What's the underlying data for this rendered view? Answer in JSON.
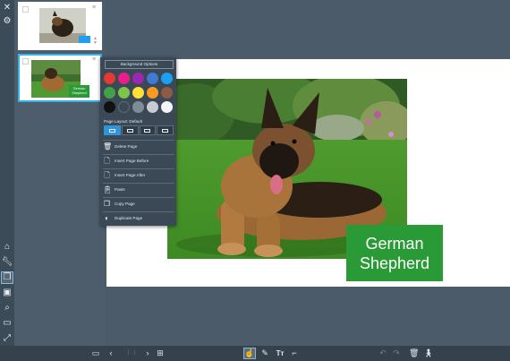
{
  "thumbnails": {
    "pages": [
      {
        "selected": false
      },
      {
        "selected": true,
        "caption_text": "German Shepherd"
      }
    ]
  },
  "canvas": {
    "caption": "German\nShepherd",
    "caption_color": "#2a9a36"
  },
  "popup": {
    "background_options_label": "Background Options",
    "swatch_colors": [
      "#e53935",
      "#e91e8c",
      "#9c27b0",
      "#3f7ad6",
      "#1ea0f2",
      "#43a047",
      "#7cc44a",
      "#ffe033",
      "#fb9a1e",
      "#8d5a43",
      "#111111",
      "#3b4957",
      "#7f8c96",
      "#c8cdd1",
      "#f3f5f6"
    ],
    "page_layout_label": "Page Layout: Default",
    "menu_items": [
      {
        "label": "Delete Page",
        "icon": "trash-icon"
      },
      {
        "label": "Insert Page Before",
        "icon": "insert-before-icon"
      },
      {
        "label": "Insert Page After",
        "icon": "insert-after-icon"
      },
      {
        "label": "Paste",
        "icon": "paste-icon"
      },
      {
        "label": "Copy Page",
        "icon": "copy-icon"
      },
      {
        "label": "Duplicate Page",
        "icon": "duplicate-icon"
      }
    ]
  },
  "rail_icons": [
    "close-icon",
    "gear-icon",
    "home-icon",
    "wrench-icon",
    "pages-icon",
    "images-icon",
    "search-icon",
    "slideshow-icon",
    "export-icon",
    "save-icon"
  ],
  "toolbar_icons": [
    "page-view-icon",
    "prev-page-icon",
    "next-page-icon",
    "add-page-icon",
    "touch-icon",
    "pen-icon",
    "text-icon",
    "paint-icon",
    "undo-icon",
    "redo-icon",
    "delete-icon",
    "walk-icon"
  ]
}
